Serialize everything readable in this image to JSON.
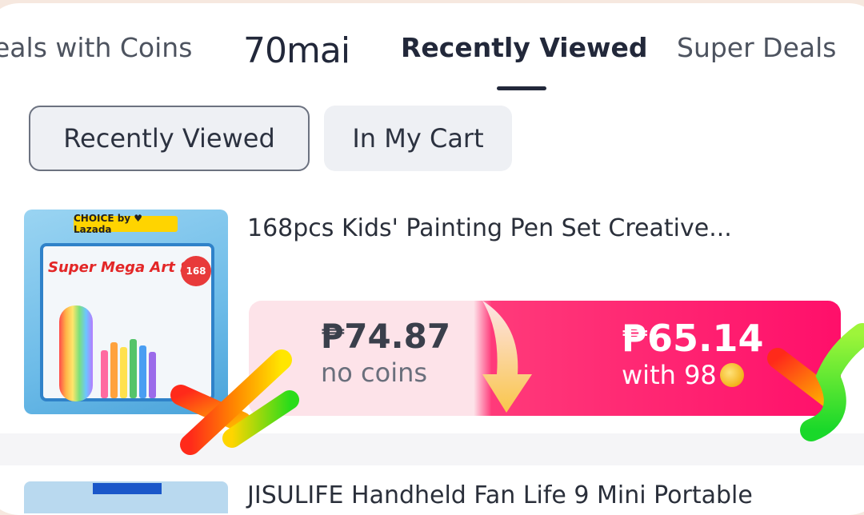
{
  "tabs": {
    "coins_label": "eals with Coins",
    "brand_label": "70mai",
    "recent_label": "Recently Viewed",
    "super_label": "Super Deals"
  },
  "filters": {
    "recently_viewed": "Recently Viewed",
    "in_my_cart": "In My Cart"
  },
  "product": {
    "title": "168pcs Kids' Painting Pen Set Creative...",
    "thumb_choice": "CHOICE by ♥ Lazada",
    "thumb_caption": "Super Mega Art Set",
    "thumb_badge": "168",
    "original_price": "₱74.87",
    "original_note": "no coins",
    "coin_price": "₱65.14",
    "coin_note": "with 98"
  },
  "next_product": {
    "title_partial": "JISULIFE Handheld Fan Life 9 Mini Portable"
  },
  "colors": {
    "accent_pink": "#ff0f6a",
    "light_pink": "#fde3e9",
    "coin_gold": "#f2b21a"
  }
}
